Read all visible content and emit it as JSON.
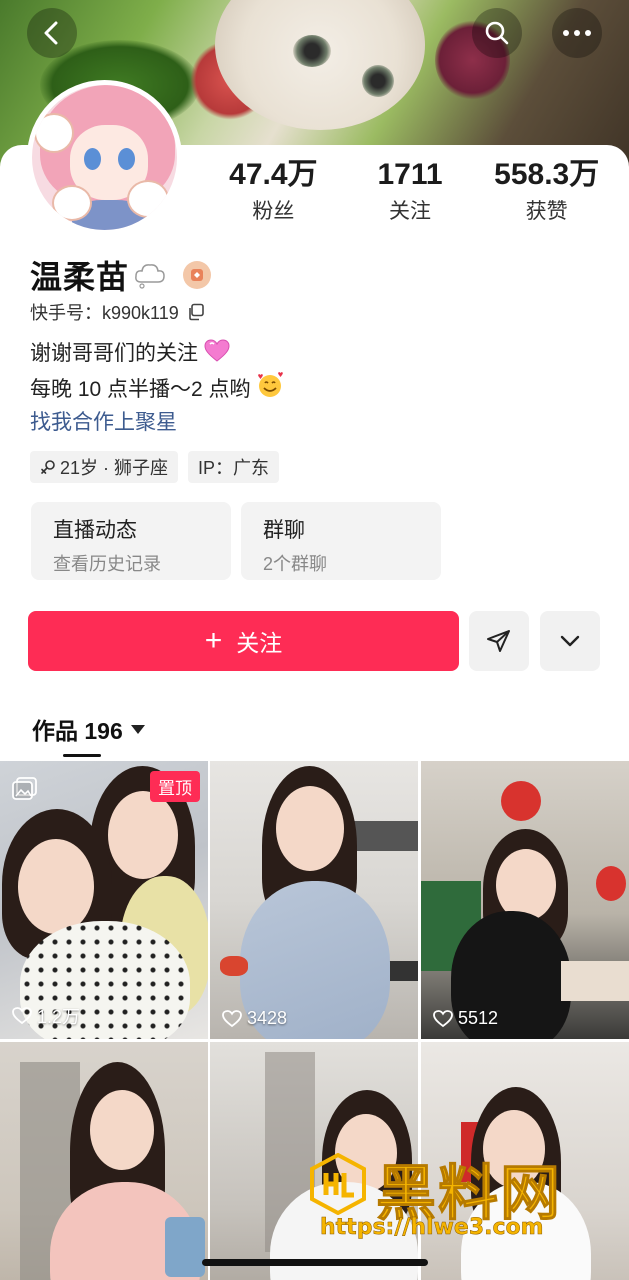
{
  "header": {
    "back_icon": "chevron-left-icon",
    "search_icon": "search-icon",
    "more_icon": "more-horizontal-icon"
  },
  "profile": {
    "name": "温柔苗",
    "kuaishou_id": "快手号：k990k119",
    "bio_line1": "谢谢哥哥们的关注",
    "bio_line2": "每晚 10 点半播～2 点哟",
    "link": "找我合作上聚星",
    "tags": [
      "21岁 · 狮子座",
      "IP：广东"
    ]
  },
  "stats": [
    {
      "value": "47.4万",
      "label": "粉丝"
    },
    {
      "value": "1711",
      "label": "关注"
    },
    {
      "value": "558.3万",
      "label": "获赞"
    }
  ],
  "cards": [
    {
      "title": "直播动态",
      "subtitle": "查看历史记录"
    },
    {
      "title": "群聊",
      "subtitle": "2个群聊"
    }
  ],
  "actions": {
    "follow_label": "关注",
    "share_icon": "send-icon",
    "expand_icon": "chevron-down-icon"
  },
  "works": {
    "tab_label": "作品 196",
    "pinned_label": "置顶",
    "items": [
      {
        "likes": "1.2万",
        "pinned": true
      },
      {
        "likes": "3428",
        "pinned": false
      },
      {
        "likes": "5512",
        "pinned": false
      },
      {
        "likes": "",
        "pinned": false
      },
      {
        "likes": "",
        "pinned": false
      },
      {
        "likes": "",
        "pinned": false
      }
    ]
  },
  "watermark": {
    "title": "黑料网",
    "url": "https://hlwe3.com"
  },
  "colors": {
    "accent": "#fe2c55",
    "link": "#3d5b8f",
    "watermark": "#f5b400"
  }
}
